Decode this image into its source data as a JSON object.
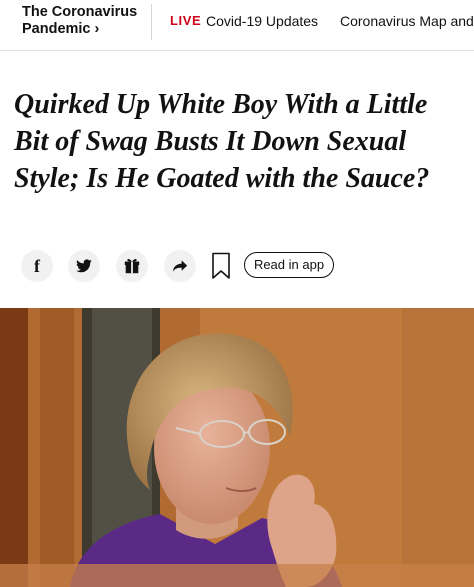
{
  "header": {
    "section_title": "The Coronavirus Pandemic ›",
    "live_label": "LIVE",
    "nav_items": [
      "Covid-19 Updates",
      "Coronavirus Map and"
    ]
  },
  "article": {
    "headline": "Quirked Up White Boy With a Little Bit of Swag Busts It Down Sexual Style; Is He Goated with the Sauce?"
  },
  "share_bar": {
    "icons": [
      "facebook-icon",
      "twitter-icon",
      "gift-icon",
      "share-arrow-icon",
      "bookmark-icon"
    ],
    "read_in_app_label": "Read in app"
  },
  "photo": {
    "subject": "woman with short blonde hair, glasses and purple top, hand on chin, against a wood-paneled background"
  },
  "colors": {
    "live_red": "#d0021b",
    "text": "#121212",
    "icon_circle_bg": "#f1f1f1",
    "photo_wood": "#b8733a",
    "photo_purple": "#5b2a86"
  }
}
